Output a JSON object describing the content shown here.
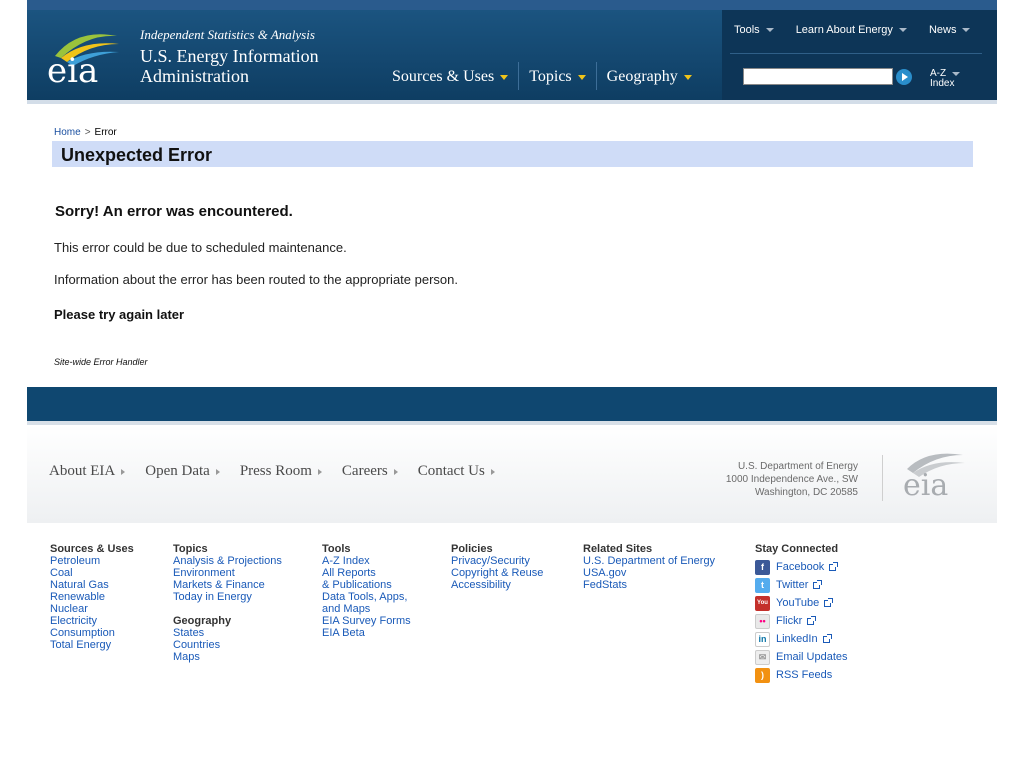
{
  "header": {
    "logo_text": "eia",
    "tagline": "Independent Statistics & Analysis",
    "agency_line1": "U.S. Energy Information",
    "agency_line2": "Administration",
    "main_nav": [
      "Sources & Uses",
      "Topics",
      "Geography"
    ],
    "tools_nav": [
      "Tools",
      "Learn About Energy",
      "News"
    ],
    "search": {
      "placeholder": "",
      "value": ""
    },
    "az_line1": "A-Z",
    "az_line2": "Index"
  },
  "breadcrumb": {
    "home": "Home",
    "sep": ">",
    "current": "Error"
  },
  "page_title": "Unexpected Error",
  "error": {
    "heading": "Sorry! An error was encountered.",
    "p1": "This error could be due to scheduled maintenance.",
    "p2": "Information about the error has been routed to the appropriate person.",
    "p3": "Please try again later",
    "handler": "Site-wide Error Handler"
  },
  "footer": {
    "nav": [
      "About EIA",
      "Open Data",
      "Press Room",
      "Careers",
      "Contact Us"
    ],
    "doe_line1": "U.S. Department of Energy",
    "doe_line2": "1000 Independence Ave., SW",
    "doe_line3": "Washington, DC 20585",
    "logo_text": "eia",
    "columns": {
      "sources": {
        "heading": "Sources & Uses",
        "links": [
          "Petroleum",
          "Coal",
          "Natural Gas",
          "Renewable",
          "Nuclear",
          "Electricity",
          "Consumption",
          "Total Energy"
        ]
      },
      "topics": {
        "heading": "Topics",
        "links": [
          "Analysis & Projections",
          "Environment",
          "Markets & Finance",
          "Today in Energy"
        ]
      },
      "geography": {
        "heading": "Geography",
        "links": [
          "States",
          "Countries",
          "Maps"
        ]
      },
      "tools": {
        "heading": "Tools",
        "links": [
          "A-Z Index",
          "All Reports",
          "& Publications",
          "Data Tools, Apps,",
          "and Maps",
          "EIA Survey Forms",
          "EIA Beta"
        ]
      },
      "policies": {
        "heading": "Policies",
        "links": [
          "Privacy/Security",
          "Copyright & Reuse",
          "Accessibility"
        ]
      },
      "related": {
        "heading": "Related Sites",
        "links": [
          "U.S. Department of Energy",
          "USA.gov",
          "FedStats"
        ]
      }
    },
    "social": {
      "heading": "Stay Connected",
      "items": [
        {
          "label": "Facebook",
          "icon": "facebook-icon",
          "glyph": "f",
          "color": "#3b5998"
        },
        {
          "label": "Twitter",
          "icon": "twitter-icon",
          "glyph": "t",
          "color": "#55acee"
        },
        {
          "label": "YouTube",
          "icon": "youtube-icon",
          "glyph": "You",
          "color": "#c4302b"
        },
        {
          "label": "Flickr",
          "icon": "flickr-icon",
          "glyph": "••",
          "color": "#e9e9e9"
        },
        {
          "label": "LinkedIn",
          "icon": "linkedin-icon",
          "glyph": "in",
          "color": "#ffffff"
        },
        {
          "label": "Email Updates",
          "icon": "email-icon",
          "glyph": "✉",
          "color": "#eeeeee"
        },
        {
          "label": "RSS Feeds",
          "icon": "rss-icon",
          "glyph": ")",
          "color": "#f29111"
        }
      ]
    }
  },
  "colors": {
    "header_bg": "#0e3d62",
    "title_bar": "#cfdcf7",
    "footer_bar": "#0f4770",
    "accent": "#f0c419",
    "link": "#1a5ab8"
  }
}
